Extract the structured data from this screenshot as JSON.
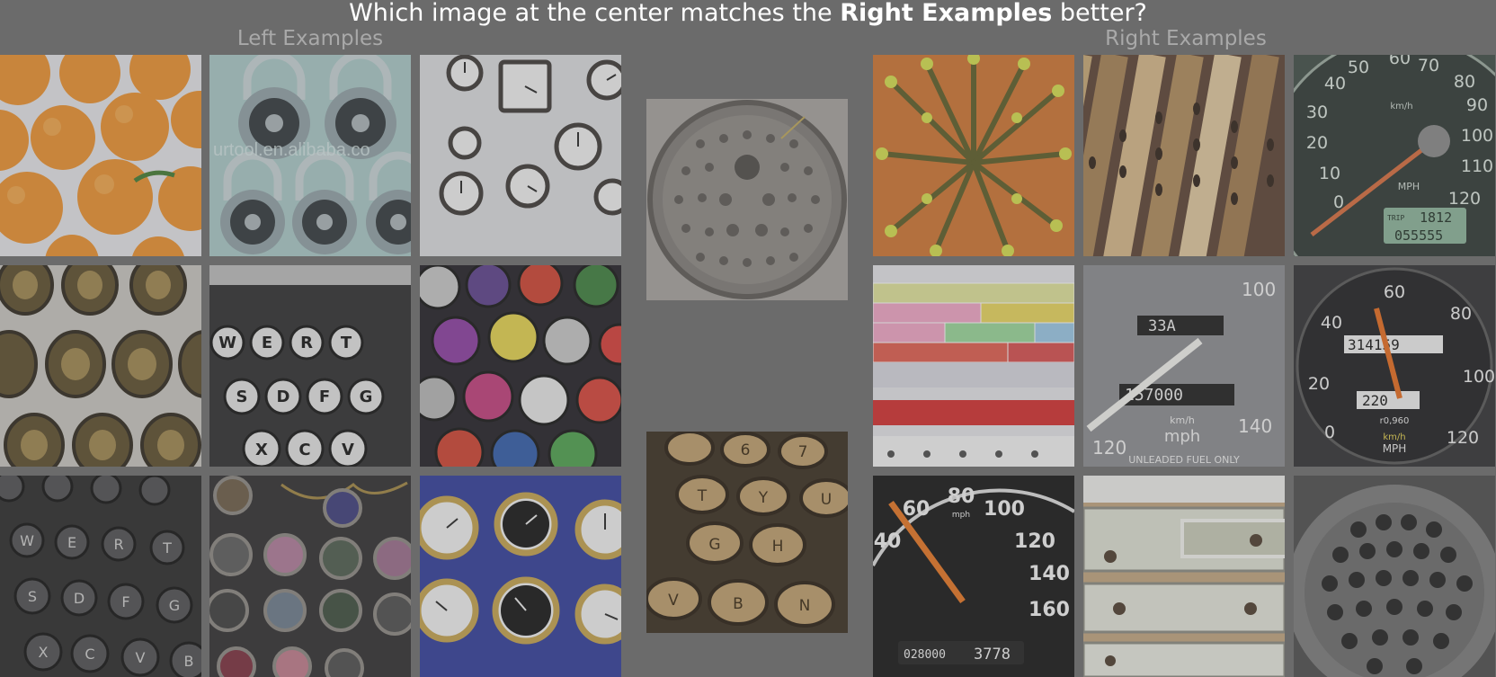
{
  "header": {
    "question_before": "Which image at the center matches the ",
    "question_emphasis": "Right Examples",
    "question_after": " better?"
  },
  "left_group": {
    "label": "Left Examples",
    "images": [
      {
        "name": "oranges-image",
        "icon": "oranges"
      },
      {
        "name": "padlocks-image",
        "icon": "combination-padlocks",
        "watermark": "urtool.en.alibaba.co"
      },
      {
        "name": "wall-clocks-image",
        "icon": "wall-clocks"
      },
      {
        "name": "ornate-frames-image",
        "icon": "ornate-frames"
      },
      {
        "name": "typewriter-keys-image",
        "icon": "typewriter-keys",
        "keys_row1": [
          "W",
          "E",
          "R",
          "T"
        ],
        "keys_row2": [
          "S",
          "D",
          "F",
          "G"
        ],
        "keys_row3": [
          "X",
          "C",
          "V"
        ]
      },
      {
        "name": "bottle-caps-image",
        "icon": "bottle-caps"
      },
      {
        "name": "dark-typewriter-image",
        "icon": "typewriter-keys-dark",
        "keys_row1": [
          "W",
          "E",
          "R",
          "T"
        ],
        "keys_row2": [
          "S",
          "D",
          "F",
          "G"
        ],
        "keys_row3": [
          "X",
          "C",
          "V",
          "B"
        ]
      },
      {
        "name": "pendants-image",
        "icon": "bottlecap-pendants"
      },
      {
        "name": "marine-clocks-image",
        "icon": "marine-clocks"
      }
    ]
  },
  "center": {
    "images": [
      {
        "name": "manhole-cover-image",
        "icon": "manhole-cover"
      },
      {
        "name": "brass-typewriter-image",
        "icon": "brass-typewriter-keys",
        "keys_row1": [
          "6",
          "7"
        ],
        "keys_row2": [
          "T",
          "Y",
          "U"
        ],
        "keys_row3": [
          "G",
          "H"
        ],
        "keys_row4": [
          "V",
          "B",
          "N"
        ]
      }
    ]
  },
  "right_group": {
    "label": "Right Examples",
    "images": [
      {
        "name": "pencils-image",
        "icon": "pencil-bundle"
      },
      {
        "name": "flutes-image",
        "icon": "bamboo-flutes"
      },
      {
        "name": "speedometer-green-image",
        "icon": "speedometer",
        "ticks": [
          "0",
          "10",
          "20",
          "30",
          "40",
          "50",
          "60",
          "70",
          "80",
          "90",
          "100",
          "110",
          "120"
        ],
        "unit": "MPH",
        "unit2": "km/h",
        "trip_label": "TRIP",
        "trip_value": "1812",
        "odo_value": "055555"
      },
      {
        "name": "counting-cubes-image",
        "icon": "counting-cubes"
      },
      {
        "name": "speedometer-silver-image",
        "icon": "speedometer",
        "ticks": [
          "100",
          "120",
          "140"
        ],
        "odo_top": "33A",
        "odo_value": "157000",
        "unit": "mph",
        "unit2": "km/h",
        "fuel_note": "UNLEADED FUEL ONLY"
      },
      {
        "name": "speedometer-dark-image",
        "icon": "speedometer",
        "ticks": [
          "0",
          "20",
          "40",
          "60",
          "80",
          "100",
          "120"
        ],
        "odo_top": "314159",
        "odo_value": "220",
        "unit": "MPH",
        "unit2": "km/h",
        "rate": "r0,960"
      },
      {
        "name": "speedometer-black-image",
        "icon": "speedometer",
        "ticks": [
          "40",
          "60",
          "80",
          "100",
          "120",
          "140",
          "160"
        ],
        "unit": "mph",
        "odo_value": "028000",
        "trip_value": "3778"
      },
      {
        "name": "dresser-image",
        "icon": "white-dresser"
      },
      {
        "name": "perforated-grille-image",
        "icon": "perforated-grille"
      }
    ]
  },
  "colors": {
    "background": "#6b6b6b",
    "question_text": "#ffffff",
    "group_label": "#a9a9a9"
  }
}
